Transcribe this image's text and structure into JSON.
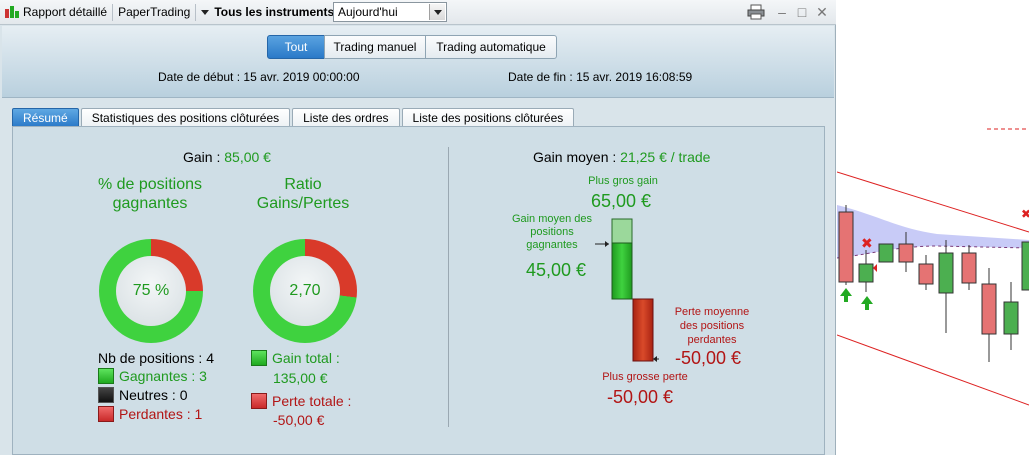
{
  "toolbar": {
    "report_label": "Rapport détaillé",
    "papertrading_label": "PaperTrading",
    "instruments_label": "Tous les instruments",
    "period_value": "Aujourd'hui"
  },
  "filter": {
    "all_label": "Tout",
    "manual_label": "Trading manuel",
    "auto_label": "Trading automatique"
  },
  "dates": {
    "start_label": "Date de début :",
    "start_value": "15 avr. 2019 00:00:00",
    "end_label": "Date de fin :",
    "end_value": "15 avr. 2019 16:08:59"
  },
  "tabs": [
    {
      "label": "Résumé"
    },
    {
      "label": "Statistiques des positions clôturées"
    },
    {
      "label": "Liste des ordres"
    },
    {
      "label": "Liste des positions clôturées"
    }
  ],
  "summary": {
    "gain_label": "Gain :",
    "gain_value": "85,00 €",
    "pct_title": "% de positions gagnantes",
    "pct_value": "75 %",
    "pct_fraction": 0.75,
    "ratio_title": "Ratio Gains/Pertes",
    "ratio_value": "2,70",
    "ratio_fraction": 0.73,
    "nb_label": "Nb de positions :",
    "nb_value": "4",
    "winners_label": "Gagnantes :",
    "winners_value": "3",
    "neutral_label": "Neutres :",
    "neutral_value": "0",
    "losers_label": "Perdantes :",
    "losers_value": "1",
    "gain_total_label": "Gain total :",
    "gain_total_value": "135,00 €",
    "loss_total_label": "Perte totale :",
    "loss_total_value": "-50,00 €"
  },
  "average": {
    "title_label": "Gain moyen :",
    "title_value": "21,25 € / trade",
    "max_gain_label": "Plus gros gain",
    "max_gain_value": "65,00 €",
    "avg_win_label_1": "Gain moyen des",
    "avg_win_label_2": "positions",
    "avg_win_label_3": "gagnantes",
    "avg_win_value": "45,00 €",
    "avg_loss_label_1": "Perte moyenne",
    "avg_loss_label_2": "des positions",
    "avg_loss_label_3": "perdantes",
    "avg_loss_value": "-50,00 €",
    "max_loss_label": "Plus grosse perte",
    "max_loss_value": "-50,00 €"
  },
  "colors": {
    "green": "#1f9a1f",
    "red": "#b21515",
    "accent": "#2a79c8"
  }
}
